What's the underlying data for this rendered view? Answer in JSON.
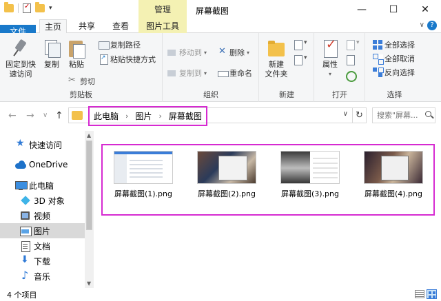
{
  "window": {
    "title": "屏幕截图",
    "context_tab_header": "管理",
    "controls": {
      "minimize": "—",
      "maximize": "☐",
      "close": "✕"
    }
  },
  "ribbon_tabs": [
    {
      "label": "文件"
    },
    {
      "label": "主页"
    },
    {
      "label": "共享"
    },
    {
      "label": "查看"
    },
    {
      "label": "图片工具"
    }
  ],
  "ribbon": {
    "clipboard": {
      "label": "剪贴板",
      "pin": "固定到快速访问",
      "pin_line1": "固定到快",
      "pin_line2": "速访问",
      "copy": "复制",
      "paste": "粘贴",
      "copy_path": "复制路径",
      "paste_shortcut": "粘贴快捷方式",
      "cut": "剪切"
    },
    "organize": {
      "label": "组织",
      "move_to": "移动到",
      "copy_to": "复制到",
      "delete": "删除",
      "rename": "重命名"
    },
    "new": {
      "label": "新建",
      "new_folder_line1": "新建",
      "new_folder_line2": "文件夹"
    },
    "open": {
      "label": "打开",
      "properties": "属性"
    },
    "select": {
      "label": "选择",
      "select_all": "全部选择",
      "select_none": "全部取消",
      "invert": "反向选择"
    }
  },
  "address": {
    "crumbs": [
      "此电脑",
      "图片",
      "屏幕截图"
    ],
    "search_placeholder": "搜索\"屏幕..."
  },
  "nav_pane": {
    "items": [
      {
        "label": "快速访问",
        "icon": "star-icon"
      },
      {
        "label": "OneDrive",
        "icon": "cloud-icon"
      },
      {
        "label": "此电脑",
        "icon": "pc-icon"
      },
      {
        "label": "3D 对象",
        "icon": "cube-icon"
      },
      {
        "label": "视频",
        "icon": "video-icon"
      },
      {
        "label": "图片",
        "icon": "pictures-icon",
        "selected": true
      },
      {
        "label": "文档",
        "icon": "document-icon"
      },
      {
        "label": "下载",
        "icon": "download-icon"
      },
      {
        "label": "音乐",
        "icon": "music-icon"
      }
    ]
  },
  "files": [
    {
      "name": "屏幕截图(1).png"
    },
    {
      "name": "屏幕截图(2).png"
    },
    {
      "name": "屏幕截图(3).png"
    },
    {
      "name": "屏幕截图(4).png"
    }
  ],
  "status": {
    "item_count": "4 个项目"
  },
  "colors": {
    "accent": "#1979ca",
    "highlight": "#d62ad1",
    "context_tab": "#f4f1b3"
  }
}
